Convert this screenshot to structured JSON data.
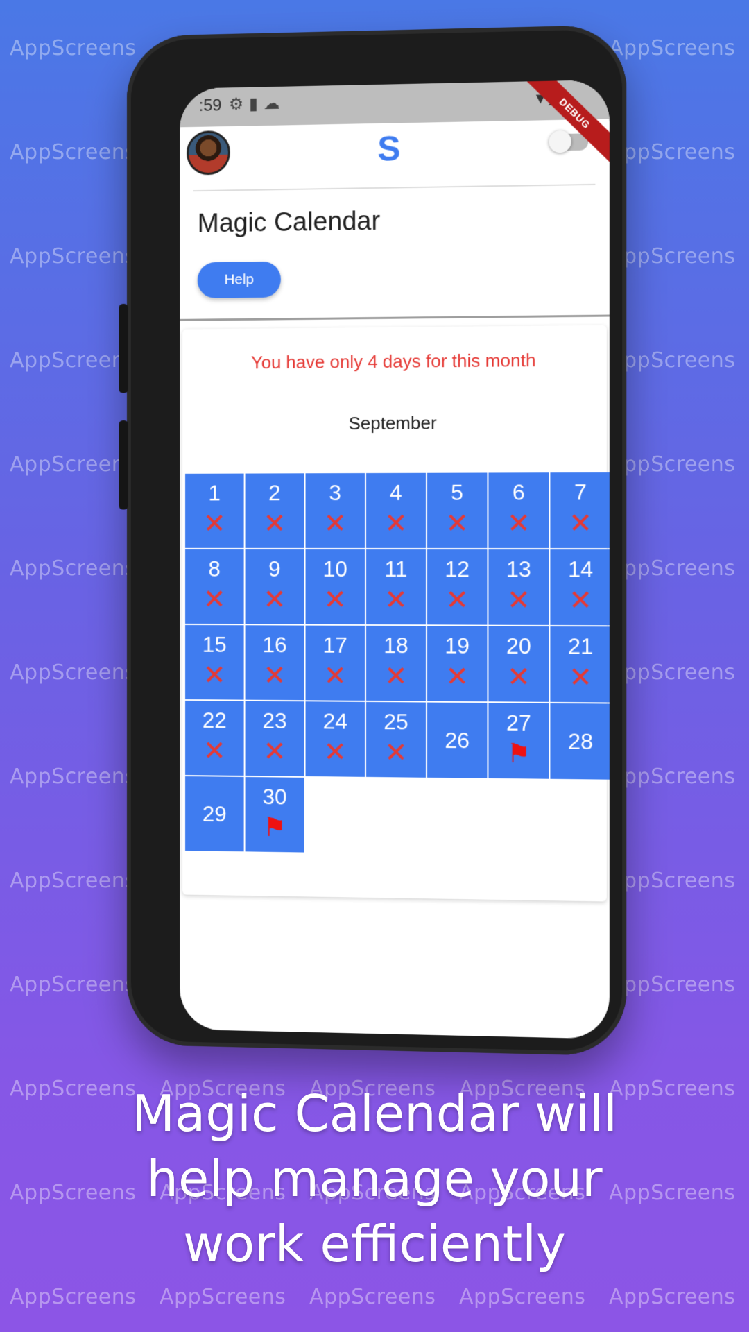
{
  "watermark": "AppScreens",
  "status_bar": {
    "time": ":59",
    "icons": [
      "gear-icon",
      "sim-icon",
      "cloud-icon"
    ],
    "right_icons": [
      "wifi-icon",
      "signal-icon"
    ],
    "debug_banner": "DEBUG"
  },
  "app_bar": {
    "logo": "S",
    "toggle_on": false
  },
  "page": {
    "title": "Magic Calendar",
    "help_label": "Help"
  },
  "calendar": {
    "warning": "You have only 4 days for this month",
    "month": "September",
    "days": [
      {
        "n": "1",
        "mark": "x"
      },
      {
        "n": "2",
        "mark": "x"
      },
      {
        "n": "3",
        "mark": "x"
      },
      {
        "n": "4",
        "mark": "x"
      },
      {
        "n": "5",
        "mark": "x"
      },
      {
        "n": "6",
        "mark": "x"
      },
      {
        "n": "7",
        "mark": "x"
      },
      {
        "n": "8",
        "mark": "x"
      },
      {
        "n": "9",
        "mark": "x"
      },
      {
        "n": "10",
        "mark": "x"
      },
      {
        "n": "11",
        "mark": "x"
      },
      {
        "n": "12",
        "mark": "x"
      },
      {
        "n": "13",
        "mark": "x"
      },
      {
        "n": "14",
        "mark": "x"
      },
      {
        "n": "15",
        "mark": "x"
      },
      {
        "n": "16",
        "mark": "x"
      },
      {
        "n": "17",
        "mark": "x"
      },
      {
        "n": "18",
        "mark": "x"
      },
      {
        "n": "19",
        "mark": "x"
      },
      {
        "n": "20",
        "mark": "x"
      },
      {
        "n": "21",
        "mark": "x"
      },
      {
        "n": "22",
        "mark": "x"
      },
      {
        "n": "23",
        "mark": "x"
      },
      {
        "n": "24",
        "mark": "x"
      },
      {
        "n": "25",
        "mark": "x"
      },
      {
        "n": "26",
        "mark": ""
      },
      {
        "n": "27",
        "mark": "flag"
      },
      {
        "n": "28",
        "mark": ""
      },
      {
        "n": "29",
        "mark": ""
      },
      {
        "n": "30",
        "mark": "flag"
      }
    ]
  },
  "tagline": [
    "Magic Calendar will",
    "help manage your",
    "work efficiently"
  ],
  "colors": {
    "accent": "#3f7cf0",
    "warning": "#e53935",
    "mark": "#e53935"
  }
}
